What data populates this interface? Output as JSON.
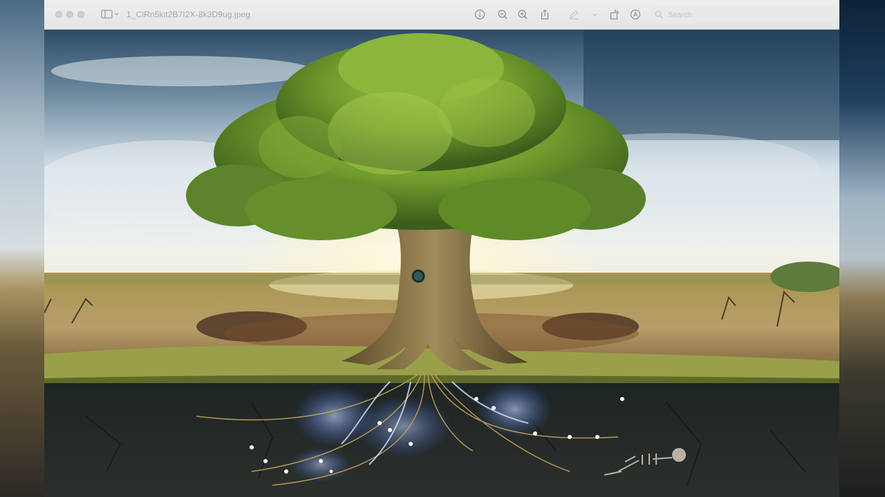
{
  "window": {
    "filename": "1_ClRn5kit2B7I2X-8k3D9ug.jpeg",
    "search": {
      "placeholder": "Search",
      "value": ""
    }
  },
  "toolbar": {
    "icons": [
      "sidebar-icon",
      "info-icon",
      "zoom-out-icon",
      "zoom-in-icon",
      "share-icon",
      "markup-pen-icon",
      "rotate-icon",
      "annotate-icon",
      "search-icon"
    ]
  },
  "image": {
    "description_subject": "tree-of-life"
  },
  "colors": {
    "titlebar": "#e9e9e9",
    "sky": "#cfdbe4",
    "foliage": "#6f9a2c",
    "soil": "#262a27",
    "roots_glow": "#8fb6ff"
  }
}
